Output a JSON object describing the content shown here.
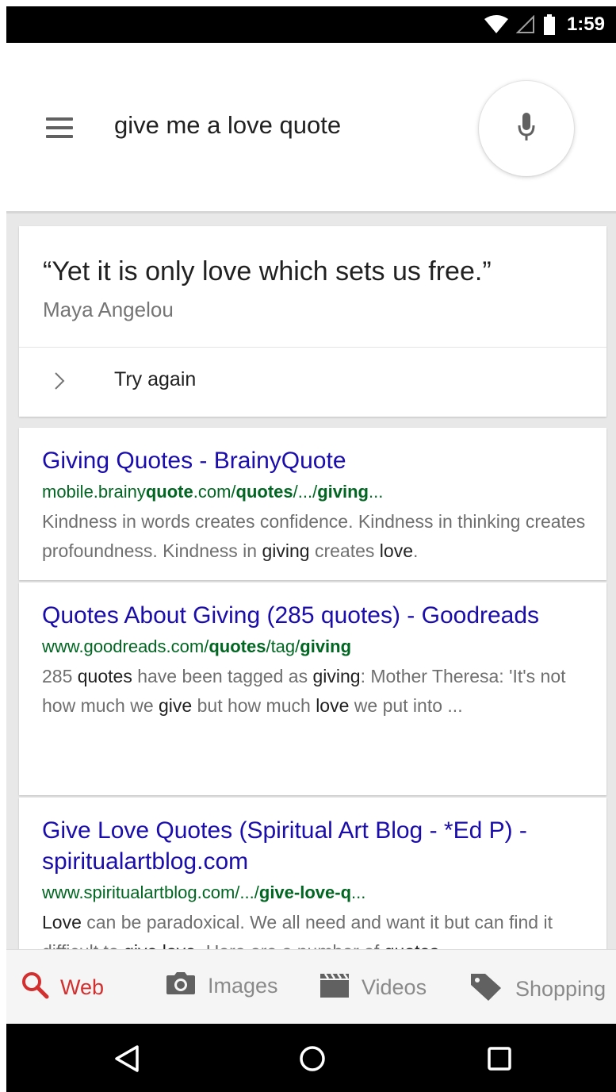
{
  "status_bar": {
    "time": "1:59",
    "icons": [
      "wifi-icon",
      "signal-icon",
      "battery-icon"
    ]
  },
  "search": {
    "query": "give me a love quote",
    "icons": [
      "menu-icon",
      "mic-icon"
    ]
  },
  "quote_card": {
    "quote": "“Yet it is only love which sets us free.”",
    "author": "Maya Angelou",
    "try_again_label": "Try again"
  },
  "results": [
    {
      "title": "Giving Quotes - BrainyQuote",
      "url_parts": [
        "mobile.brainy",
        "quote",
        ".com/",
        "quotes",
        "/.../",
        "giving",
        "..."
      ],
      "snippet_parts": [
        "Kindness in words creates confidence. Kindness in thinking creates profoundness. Kindness in ",
        "giving",
        " creates ",
        "love",
        "."
      ]
    },
    {
      "title": "Quotes About Giving (285 quotes) - Goodreads",
      "url_parts": [
        "www.goodreads.com/",
        "quotes",
        "/tag/",
        "giving"
      ],
      "snippet_parts": [
        "285 ",
        "quotes",
        " have been tagged as ",
        "giving",
        ": Mother Theresa: 'It's not how much we ",
        "give",
        " but how much ",
        "love",
        " we put into ..."
      ]
    },
    {
      "title": "Give Love Quotes (Spiritual Art Blog - *Ed P) - spiritualartblog.com",
      "url_parts": [
        "www.spiritualartblog.com/.../",
        "give-love-q",
        "..."
      ],
      "snippet_parts": [
        "Love",
        " can be paradoxical. We all need and want it but can find it difficult to ",
        "give love",
        ". Here are a number of ",
        "quotes",
        ""
      ]
    }
  ],
  "tabs": [
    {
      "label": "Web",
      "icon": "search-icon",
      "active": true
    },
    {
      "label": "Images",
      "icon": "camera-icon",
      "active": false
    },
    {
      "label": "Videos",
      "icon": "clapperboard-icon",
      "active": false
    },
    {
      "label": "Shopping",
      "icon": "tag-icon",
      "active": false
    }
  ],
  "nav": [
    "back-icon",
    "home-icon",
    "recent-apps-icon"
  ],
  "colors": {
    "link": "#1a0dab",
    "url": "#006621",
    "active_tab": "#d32f2f",
    "inactive_tab": "#8a8a8a"
  }
}
